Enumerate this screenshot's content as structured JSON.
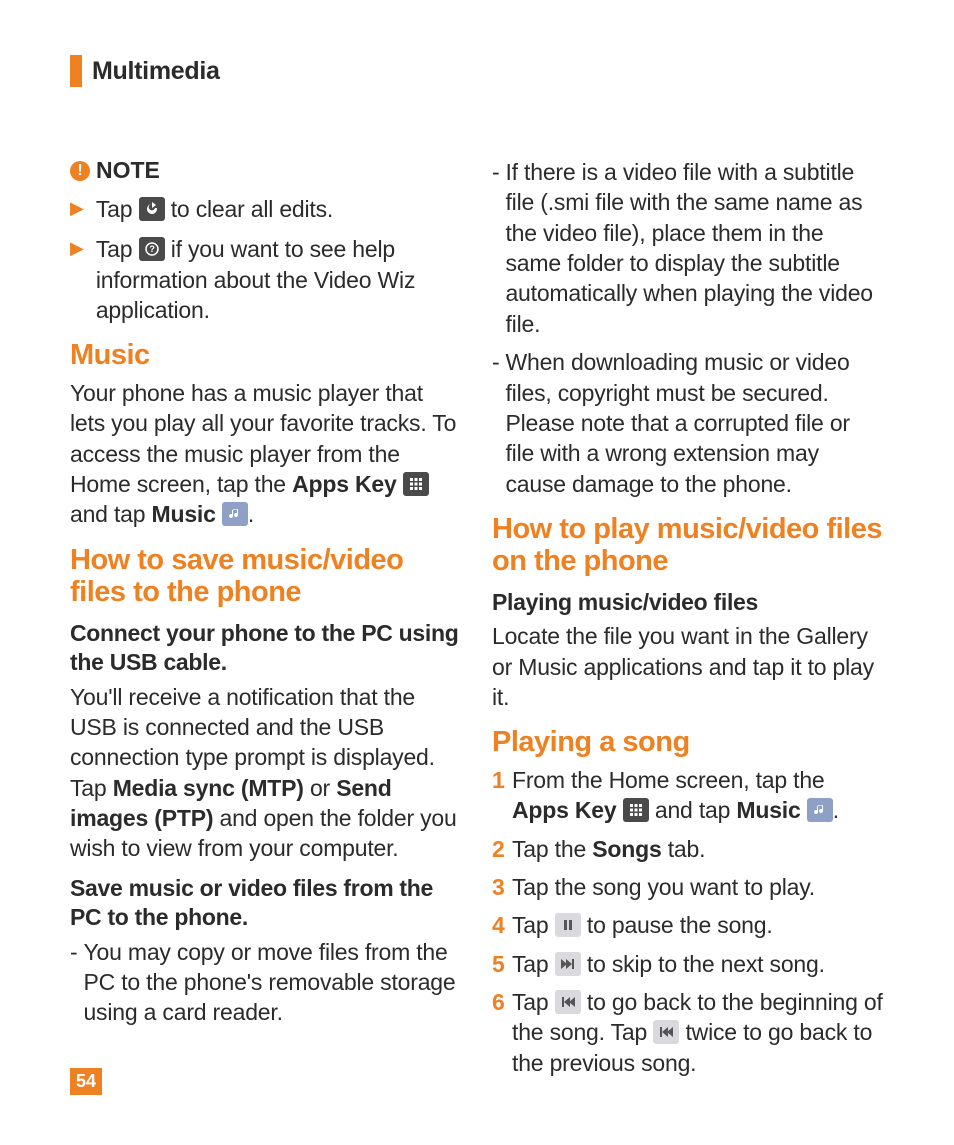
{
  "chapter": "Multimedia",
  "page_number": "54",
  "left": {
    "note_label": "NOTE",
    "note_items": [
      {
        "pre": "Tap ",
        "icon": "reset-icon",
        "post": " to clear all edits."
      },
      {
        "pre": "Tap ",
        "icon": "help-icon",
        "post": " if you want to see help information about the Video Wiz application."
      }
    ],
    "h_music": "Music",
    "music_p_pre": "Your phone has a music player that lets you play all your favorite tracks. To access the music player from the Home screen, tap the ",
    "apps_key": "Apps Key",
    "music_p_mid": " and tap ",
    "music_label": "Music",
    "h_save": "How to save music/video files to the phone",
    "sub_connect": "Connect your phone to the PC using the USB cable",
    "connect_p_a": "You'll receive a notification that the USB is connected and the USB connection type prompt is displayed. Tap ",
    "mtp": "Media sync (MTP)",
    "or": " or ",
    "ptp": "Send images (PTP)",
    "connect_p_b": " and open the folder you wish to view from your computer.",
    "sub_save": "Save music or video files from the PC to the phone",
    "dash1": "You may copy or move files from the PC to the phone's removable storage using a card reader."
  },
  "right": {
    "dash2": "If there is a video file with a subtitle file (.smi file with the same name as the video file), place them in the same folder to display the subtitle automatically when playing the video file.",
    "dash3": "When downloading music or video files, copyright must be secured. Please note that a corrupted file or file with a wrong extension may cause damage to the phone.",
    "h_play_files": "How to play music/video files on the phone",
    "sub_play": "Playing music/video files",
    "play_p": "Locate the file you want in the Gallery or Music applications and tap it to play it.",
    "h_play_song": "Playing a song",
    "steps": {
      "s1_a": "From the Home screen, tap the ",
      "s1_apps": "Apps Key",
      "s1_b": " and tap ",
      "s1_music": "Music",
      "s2_a": "Tap the ",
      "s2_songs": "Songs",
      "s2_b": " tab.",
      "s3": "Tap the song you want to play.",
      "s4_a": "Tap ",
      "s4_b": " to pause the song.",
      "s5_a": "Tap ",
      "s5_b": " to skip to the next song.",
      "s6_a": "Tap ",
      "s6_b": " to go back to the beginning of the song. Tap ",
      "s6_c": " twice to go back to the previous song."
    }
  }
}
